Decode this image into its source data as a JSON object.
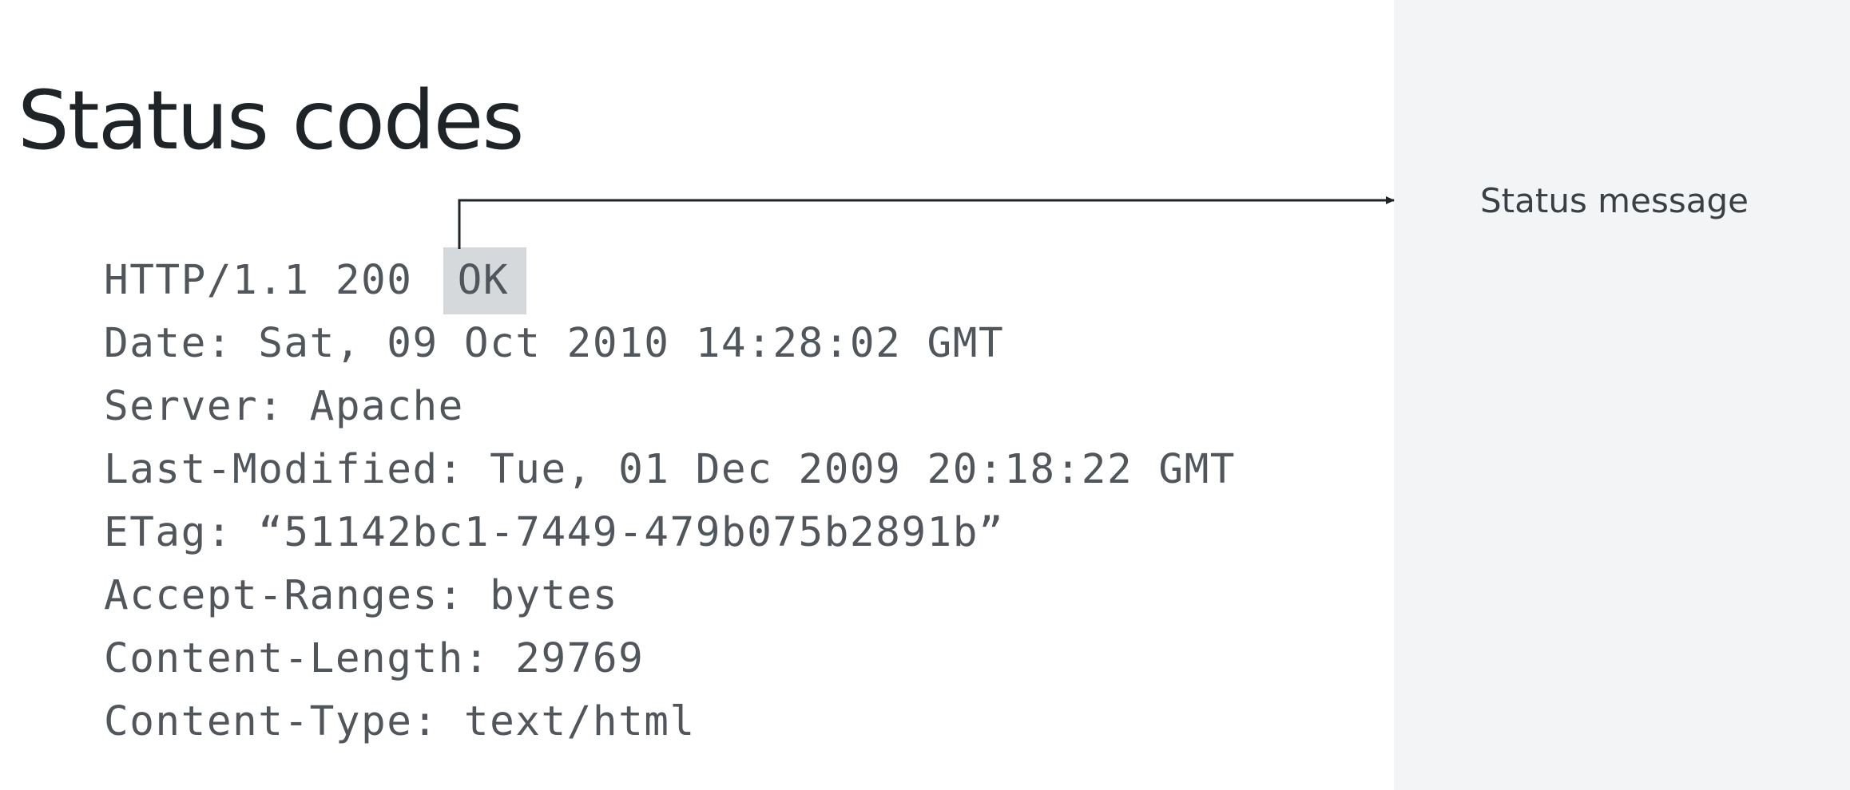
{
  "slide": {
    "title": "Status codes",
    "annotation": "Status message"
  },
  "http_response": {
    "status_line_prefix": "HTTP/1.1 200 ",
    "status_message": "OK",
    "headers": [
      "Date: Sat, 09 Oct 2010 14:28:02 GMT",
      "Server: Apache",
      "Last-Modified: Tue, 01 Dec 2009 20:18:22 GMT",
      "ETag: “51142bc1-7449-479b075b2891b”",
      "Accept-Ranges: bytes",
      "Content-Length: 29769",
      "Content-Type: text/html"
    ]
  },
  "colors": {
    "highlight": "#d6d9dc",
    "panel": "#f3f4f6",
    "connector": "#1f2428"
  }
}
